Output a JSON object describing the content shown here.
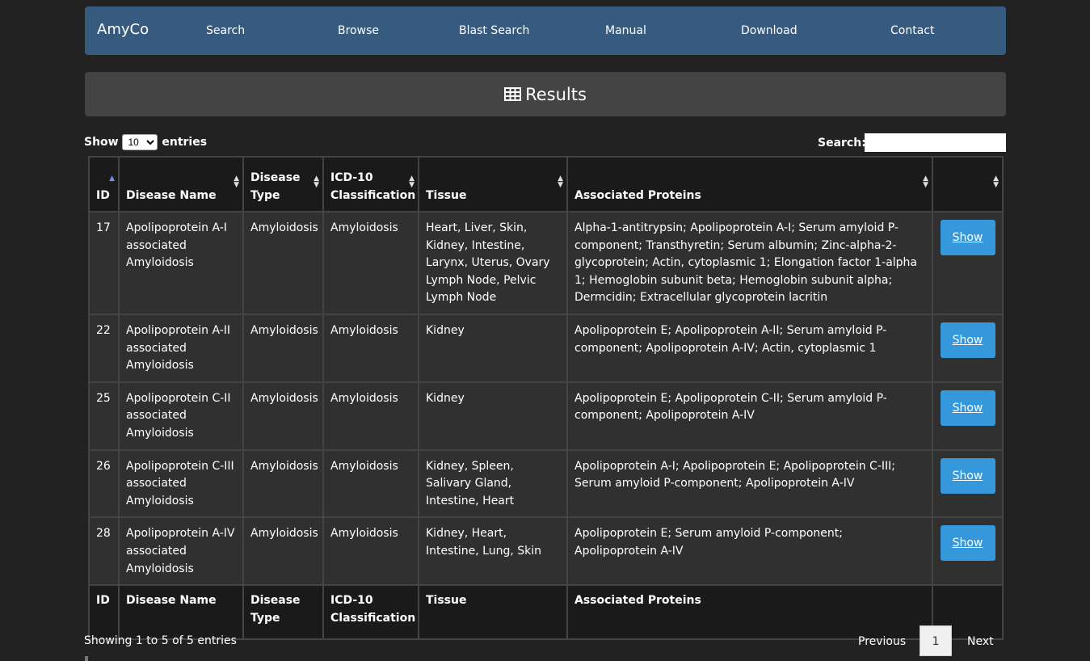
{
  "navbar": {
    "brand": "AmyCo",
    "items": [
      "Search",
      "Browse",
      "Blast Search",
      "Manual",
      "Download",
      "Contact"
    ]
  },
  "panel": {
    "title": "Results",
    "icon": "table-icon"
  },
  "controls": {
    "show_label": "Show",
    "entries_value": "10",
    "entries_label": "entries",
    "search_label": "Search:",
    "search_value": ""
  },
  "table": {
    "headers": [
      "ID",
      "Disease Name",
      "Disease Type",
      "ICD-10 Classification",
      "Tissue",
      "Associated Proteins",
      ""
    ],
    "rows": [
      {
        "id": "17",
        "disease": "Apolipoprotein A-I associated Amyloidosis",
        "type": "Amyloidosis",
        "icd": "Amyloidosis",
        "tissue": "Heart, Liver, Skin, Kidney, Intestine, Larynx, Uterus, Ovary Lymph Node, Pelvic Lymph Node",
        "proteins": "Alpha-1-antitrypsin; Apolipoprotein A-I; Serum amyloid P-component; Transthyretin; Serum albumin; Zinc-alpha-2-glycoprotein; Actin, cytoplasmic 1; Elongation factor 1-alpha 1; Hemoglobin subunit beta; Hemoglobin subunit alpha; Dermcidin; Extracellular glycoprotein lacritin",
        "button": "Show"
      },
      {
        "id": "22",
        "disease": "Apolipoprotein A-II associated Amyloidosis",
        "type": "Amyloidosis",
        "icd": "Amyloidosis",
        "tissue": "Kidney",
        "proteins": "Apolipoprotein E; Apolipoprotein A-II; Serum amyloid P-component; Apolipoprotein A-IV; Actin, cytoplasmic 1",
        "button": "Show"
      },
      {
        "id": "25",
        "disease": "Apolipoprotein C-II associated Amyloidosis",
        "type": "Amyloidosis",
        "icd": "Amyloidosis",
        "tissue": "Kidney",
        "proteins": "Apolipoprotein E; Apolipoprotein C-II; Serum amyloid P-component; Apolipoprotein A-IV",
        "button": "Show"
      },
      {
        "id": "26",
        "disease": "Apolipoprotein C-III associated Amyloidosis",
        "type": "Amyloidosis",
        "icd": "Amyloidosis",
        "tissue": "Kidney, Spleen, Salivary Gland, Intestine, Heart",
        "proteins": "Apolipoprotein A-I; Apolipoprotein E; Apolipoprotein C-III; Serum amyloid P-component; Apolipoprotein A-IV",
        "button": "Show"
      },
      {
        "id": "28",
        "disease": "Apolipoprotein A-IV associated Amyloidosis",
        "type": "Amyloidosis",
        "icd": "Amyloidosis",
        "tissue": "Kidney, Heart, Intestine, Lung, Skin",
        "proteins": "Apolipoprotein E; Serum amyloid P-component; Apolipoprotein A-IV",
        "button": "Show"
      }
    ]
  },
  "footer": {
    "info": "Showing 1 to 5 of 5 entries",
    "previous": "Previous",
    "page": "1",
    "next": "Next"
  }
}
